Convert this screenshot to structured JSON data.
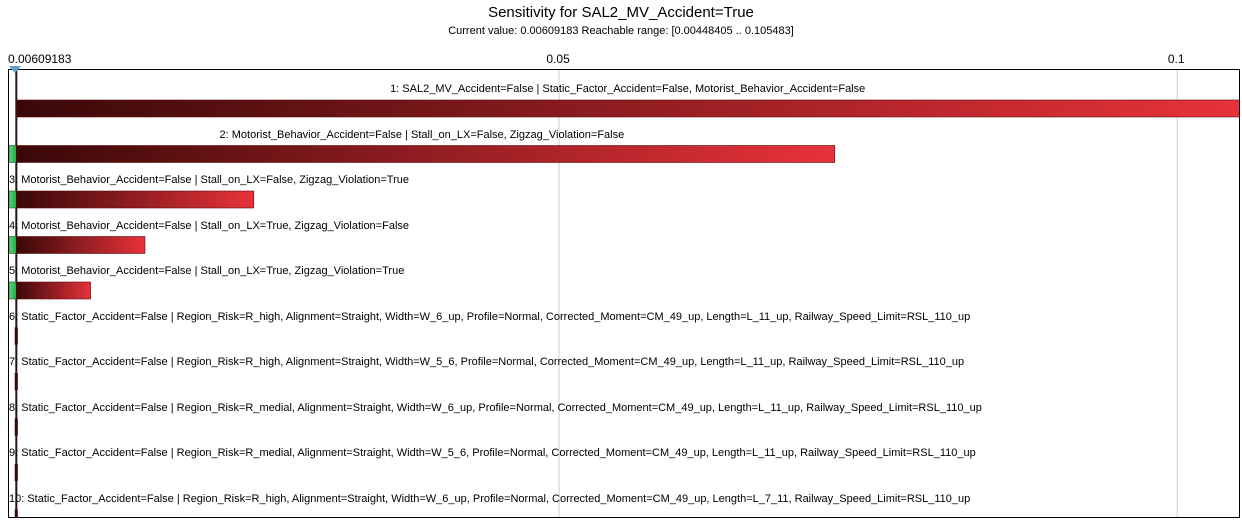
{
  "title": "Sensitivity for SAL2_MV_Accident=True",
  "subtitle": {
    "current_label": "Current value:",
    "current_value": "0.00609183",
    "range_label": "Reachable range:",
    "range_value": "[0.00448405 .. 0.105483]"
  },
  "colors": {
    "bar_dark": "#3a0808",
    "bar_red": "#e8323a",
    "bar_green": "#1faa4b",
    "grid": "#d0d0d0",
    "baseline": "#2a1010",
    "marker": "#5a9fd4"
  },
  "icons": {
    "current_value_marker": "down-triangle"
  },
  "chart_data": {
    "type": "bar",
    "orientation": "horizontal-tornado",
    "title": "Sensitivity for SAL2_MV_Accident=True",
    "current_value": 0.00609183,
    "reachable_range": [
      0.00448405,
      0.105483
    ],
    "x_ticks": [
      {
        "value": 0.00609183,
        "label": "0.00609183"
      },
      {
        "value": 0.05,
        "label": "0.05"
      },
      {
        "value": 0.1,
        "label": "0.1"
      }
    ],
    "xlim": [
      0.0055,
      0.105
    ],
    "grid": true,
    "bars": [
      {
        "label": "1: SAL2_MV_Accident=False | Static_Factor_Accident=False, Motorist_Behavior_Accident=False",
        "low": 0.00609183,
        "high": 0.105483,
        "label_align": "center"
      },
      {
        "label": "2: Motorist_Behavior_Accident=False | Stall_on_LX=False, Zigzag_Violation=False",
        "low": 0.00448405,
        "high": 0.0723,
        "label_align": "center"
      },
      {
        "label": "3: Motorist_Behavior_Accident=False | Stall_on_LX=False, Zigzag_Violation=True",
        "low": 0.00448405,
        "high": 0.0253,
        "label_align": "left"
      },
      {
        "label": "4: Motorist_Behavior_Accident=False | Stall_on_LX=True, Zigzag_Violation=False",
        "low": 0.00478,
        "high": 0.0165,
        "label_align": "left"
      },
      {
        "label": "5: Motorist_Behavior_Accident=False | Stall_on_LX=True, Zigzag_Violation=True",
        "low": 0.00448405,
        "high": 0.0121,
        "label_align": "left"
      },
      {
        "label": "6: Static_Factor_Accident=False | Region_Risk=R_high, Alignment=Straight, Width=W_6_up, Profile=Normal, Corrected_Moment=CM_49_up, Length=L_11_up, Railway_Speed_Limit=RSL_110_up",
        "low": 0.006,
        "high": 0.00618,
        "label_align": "left"
      },
      {
        "label": "7: Static_Factor_Accident=False | Region_Risk=R_high, Alignment=Straight, Width=W_5_6, Profile=Normal, Corrected_Moment=CM_49_up, Length=L_11_up, Railway_Speed_Limit=RSL_110_up",
        "low": 0.006,
        "high": 0.00618,
        "label_align": "left"
      },
      {
        "label": "8: Static_Factor_Accident=False | Region_Risk=R_medial, Alignment=Straight, Width=W_6_up, Profile=Normal, Corrected_Moment=CM_49_up, Length=L_11_up, Railway_Speed_Limit=RSL_110_up",
        "low": 0.006,
        "high": 0.00618,
        "label_align": "left"
      },
      {
        "label": "9: Static_Factor_Accident=False | Region_Risk=R_medial, Alignment=Straight, Width=W_5_6, Profile=Normal, Corrected_Moment=CM_49_up, Length=L_11_up, Railway_Speed_Limit=RSL_110_up",
        "low": 0.006,
        "high": 0.00618,
        "label_align": "left"
      },
      {
        "label": "10: Static_Factor_Accident=False | Region_Risk=R_high, Alignment=Straight, Width=W_6_up, Profile=Normal, Corrected_Moment=CM_49_up, Length=L_7_11, Railway_Speed_Limit=RSL_110_up",
        "low": 0.006,
        "high": 0.00618,
        "label_align": "left"
      }
    ]
  }
}
